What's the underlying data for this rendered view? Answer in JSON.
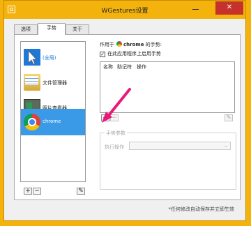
{
  "window": {
    "title": "WGestures设置",
    "close_glyph": "✕"
  },
  "tabs": [
    {
      "label": "选项",
      "active": false
    },
    {
      "label": "手势",
      "active": true
    },
    {
      "label": "关于",
      "active": false
    }
  ],
  "apps": [
    {
      "label": "(全局)",
      "icon": "cursor-icon"
    },
    {
      "label": "文件管理器",
      "icon": "folder-icon"
    },
    {
      "label": "照片查看器",
      "icon": "photo-viewer-icon"
    },
    {
      "label": "chrome",
      "icon": "chrome-icon",
      "selected": true
    }
  ],
  "applies_to": {
    "prefix": "作用于",
    "app": "chrome",
    "suffix": "的手势:"
  },
  "enable": {
    "label": "在此应用程序上启用手势",
    "checked": true,
    "check_glyph": "✓"
  },
  "gesture_table": {
    "columns": [
      "名称",
      "助记符",
      "操作"
    ]
  },
  "buttons": {
    "add": "+",
    "remove": "−",
    "edit": "✎"
  },
  "params": {
    "legend": "手势参数",
    "exec_label": "执行操作",
    "dropdown_arrow": "⌄"
  },
  "hint": "*任何修改自动保存并立即生效",
  "colors": {
    "accent": "#f3b20c",
    "selection": "#3a9ae8",
    "arrow": "#e8197a"
  }
}
